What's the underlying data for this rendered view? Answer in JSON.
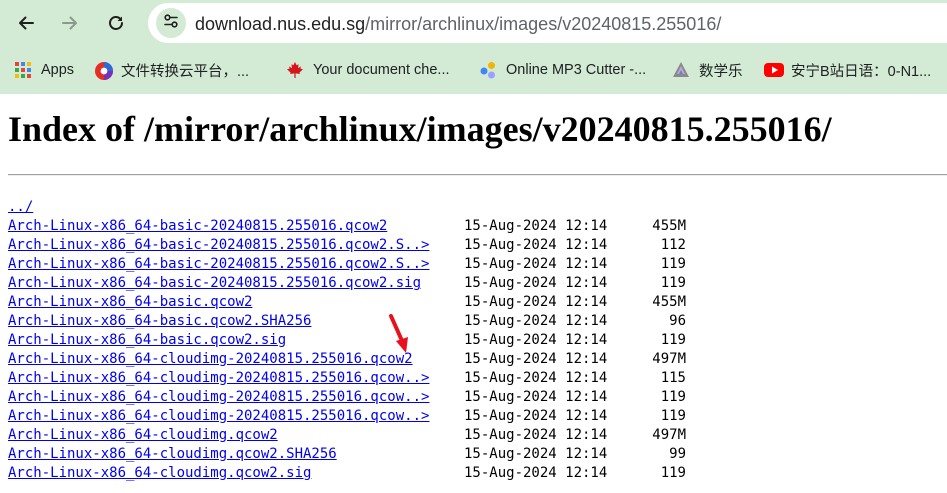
{
  "browser": {
    "url_host": "download.nus.edu.sg",
    "url_path": "/mirror/archlinux/images/v20240815.255016/",
    "bookmarks": [
      {
        "label": "Apps",
        "icon": "apps-grid-icon"
      },
      {
        "label": "文件转换云平台，...",
        "icon": "converter-icon"
      },
      {
        "label": "Your document che...",
        "icon": "maple-leaf-icon"
      },
      {
        "label": "Online MP3 Cutter -...",
        "icon": "mp3-cutter-icon"
      },
      {
        "label": "数学乐",
        "icon": "math-icon"
      },
      {
        "label": "安宁B站日语：0-N1...",
        "icon": "youtube-icon"
      }
    ]
  },
  "page": {
    "title": "Index of /mirror/archlinux/images/v20240815.255016/",
    "parent_link": "../",
    "files": [
      {
        "name": "Arch-Linux-x86_64-basic-20240815.255016.qcow2",
        "date": "15-Aug-2024 12:14",
        "size": "455M"
      },
      {
        "name": "Arch-Linux-x86_64-basic-20240815.255016.qcow2.S..>",
        "date": "15-Aug-2024 12:14",
        "size": "112"
      },
      {
        "name": "Arch-Linux-x86_64-basic-20240815.255016.qcow2.S..>",
        "date": "15-Aug-2024 12:14",
        "size": "119"
      },
      {
        "name": "Arch-Linux-x86_64-basic-20240815.255016.qcow2.sig",
        "date": "15-Aug-2024 12:14",
        "size": "119"
      },
      {
        "name": "Arch-Linux-x86_64-basic.qcow2",
        "date": "15-Aug-2024 12:14",
        "size": "455M"
      },
      {
        "name": "Arch-Linux-x86_64-basic.qcow2.SHA256",
        "date": "15-Aug-2024 12:14",
        "size": "96"
      },
      {
        "name": "Arch-Linux-x86_64-basic.qcow2.sig",
        "date": "15-Aug-2024 12:14",
        "size": "119"
      },
      {
        "name": "Arch-Linux-x86_64-cloudimg-20240815.255016.qcow2",
        "date": "15-Aug-2024 12:14",
        "size": "497M"
      },
      {
        "name": "Arch-Linux-x86_64-cloudimg-20240815.255016.qcow..>",
        "date": "15-Aug-2024 12:14",
        "size": "115"
      },
      {
        "name": "Arch-Linux-x86_64-cloudimg-20240815.255016.qcow..>",
        "date": "15-Aug-2024 12:14",
        "size": "119"
      },
      {
        "name": "Arch-Linux-x86_64-cloudimg-20240815.255016.qcow..>",
        "date": "15-Aug-2024 12:14",
        "size": "119"
      },
      {
        "name": "Arch-Linux-x86_64-cloudimg.qcow2",
        "date": "15-Aug-2024 12:14",
        "size": "497M"
      },
      {
        "name": "Arch-Linux-x86_64-cloudimg.qcow2.SHA256",
        "date": "15-Aug-2024 12:14",
        "size": "99"
      },
      {
        "name": "Arch-Linux-x86_64-cloudimg.qcow2.sig",
        "date": "15-Aug-2024 12:14",
        "size": "119"
      }
    ]
  },
  "colors": {
    "chrome": "#d3ebd4",
    "link": "#0000ee",
    "annotation_arrow": "#e8101a"
  }
}
